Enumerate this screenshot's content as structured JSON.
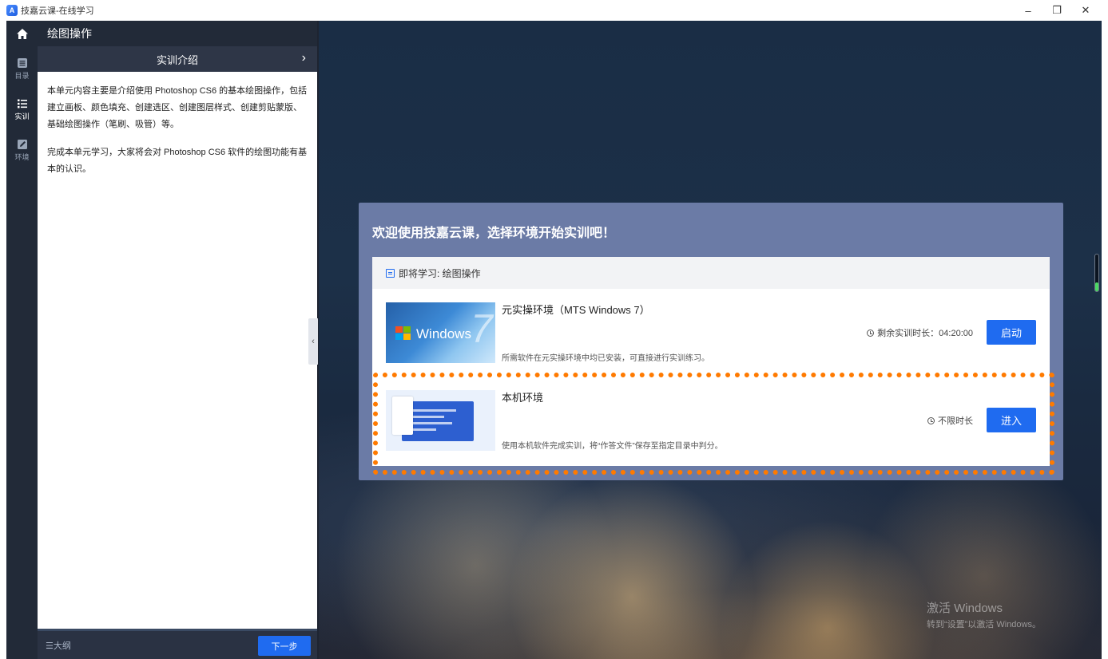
{
  "window": {
    "title": "技嘉云课-在线学习",
    "logo_text": "A",
    "controls": [
      "–",
      "❐",
      "✕"
    ]
  },
  "rail": {
    "home_icon": "home-icon",
    "items": [
      {
        "label": "目录",
        "icon": "list-icon"
      },
      {
        "label": "实训",
        "icon": "numbered-list-icon"
      },
      {
        "label": "环境",
        "icon": "edit-icon"
      }
    ]
  },
  "panel": {
    "header": "绘图操作",
    "subheader": "实训介绍",
    "paragraphs": [
      "本单元内容主要是介绍使用 Photoshop CS6 的基本绘图操作，包括建立画板、颜色填充、创建选区、创建图层样式、创建剪贴蒙版、基础绘图操作（笔刷、吸管）等。",
      "完成本单元学习，大家将会对 Photoshop CS6 软件的绘图功能有基本的认识。"
    ],
    "footer_link": "☰大纲",
    "next_button": "下一步"
  },
  "dialog": {
    "title": "欢迎使用技嘉云课，选择环境开始实训吧！",
    "card_header": "即将学习: 绘图操作",
    "environments": [
      {
        "name": "元实操环境（MTS Windows 7）",
        "time": "剩余实训时长：04:20:00",
        "desc": "所需软件在元实操环境中均已安装，可直接进行实训练习。",
        "button": "启动",
        "thumb_text": "Windows",
        "thumb_big": "7"
      },
      {
        "name": "本机环境",
        "time": "不限时长",
        "desc": "使用本机软件完成实训，将“作答文件”保存至指定目录中判分。",
        "button": "进入"
      }
    ]
  },
  "watermark": {
    "line1": "激活 Windows",
    "line2": "转到“设置”以激活 Windows。"
  },
  "colors": {
    "accent": "#1f6bf0",
    "highlight": "#ff7a00",
    "dialog_bg": "#6b7ba6",
    "rail_bg": "#222a38"
  },
  "scroll_level": 0.25
}
